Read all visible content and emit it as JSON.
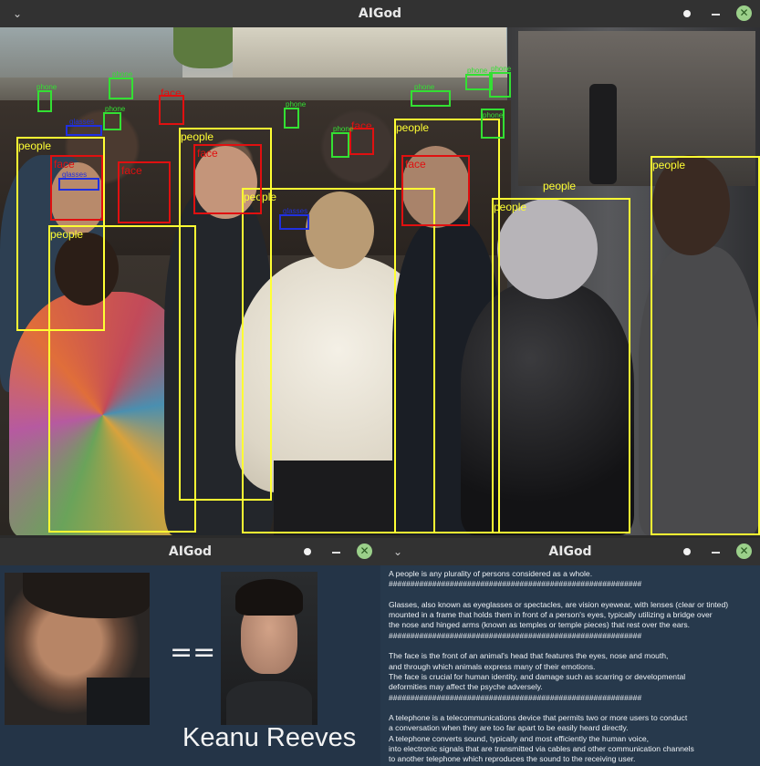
{
  "colors": {
    "people_box": "#ffff33",
    "face_box": "#e01010",
    "glasses_box": "#2030e0",
    "phone_box": "#33e033",
    "panel_bg": "#27394c"
  },
  "main_window": {
    "title": "AIGod",
    "menu_icon": "chevron-down-icon"
  },
  "detections": [
    {
      "label": "people",
      "kind": "people"
    },
    {
      "label": "people",
      "kind": "people"
    },
    {
      "label": "people",
      "kind": "people"
    },
    {
      "label": "people",
      "kind": "people"
    },
    {
      "label": "people",
      "kind": "people"
    },
    {
      "label": "people",
      "kind": "people"
    },
    {
      "label": "people",
      "kind": "people"
    },
    {
      "label": "people",
      "kind": "people"
    },
    {
      "label": "people",
      "kind": "people"
    },
    {
      "label": "face",
      "kind": "face"
    },
    {
      "label": "face",
      "kind": "face"
    },
    {
      "label": "face",
      "kind": "face"
    },
    {
      "label": "face",
      "kind": "face"
    },
    {
      "label": "face",
      "kind": "face"
    },
    {
      "label": "face",
      "kind": "face"
    },
    {
      "label": "glasses",
      "kind": "glasses"
    },
    {
      "label": "glasses",
      "kind": "glasses"
    },
    {
      "label": "glasses",
      "kind": "glasses"
    },
    {
      "label": "phone",
      "kind": "phone"
    },
    {
      "label": "phone",
      "kind": "phone"
    },
    {
      "label": "phone",
      "kind": "phone"
    },
    {
      "label": "phone",
      "kind": "phone"
    },
    {
      "label": "phone",
      "kind": "phone"
    },
    {
      "label": "phone",
      "kind": "phone"
    },
    {
      "label": "phone",
      "kind": "phone"
    },
    {
      "label": "phone",
      "kind": "phone"
    },
    {
      "label": "phone",
      "kind": "phone"
    }
  ],
  "compare_window": {
    "title": "AIGod",
    "operator": "==",
    "person_name": "Keanu Reeves"
  },
  "info_window": {
    "title": "AIGod",
    "lines": [
      "A people is any plurality of persons considered as a whole.",
      "##########################################################",
      "",
      "Glasses, also known as eyeglasses or spectacles, are vision eyewear, with lenses (clear or tinted)",
      "mounted in a frame that holds them in front of a person's eyes, typically utilizing a bridge over",
      "the nose and hinged arms (known as temples or temple pieces) that rest over the ears.",
      "##########################################################",
      "",
      "The face is the front of an animal's head that features the eyes, nose and mouth,",
      "and through which animals express many of their emotions.",
      "The face is crucial for human identity, and damage such as scarring or developmental",
      "deformities may affect the psyche adversely.",
      "##########################################################",
      "",
      "A telephone is a telecommunications device that permits two or more users to conduct",
      "a conversation when they are too far apart to be easily heard directly.",
      "A telephone converts sound, typically and most efficiently the human voice,",
      "into electronic signals that are transmitted via cables and other communication channels",
      "to another telephone which reproduces the sound to the receiving user."
    ]
  }
}
